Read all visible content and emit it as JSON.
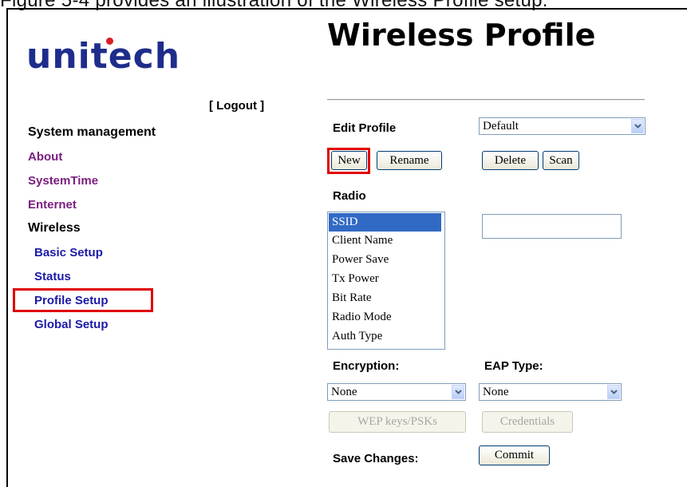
{
  "header": {
    "cut_text": "Figure 5-4 provides an illustration of the Wireless Profile setup.",
    "logo": "unitech",
    "logout_left": "[",
    "logout_link": "Logout",
    "logout_right": "]",
    "page_title": "Wireless Profile"
  },
  "sidebar": {
    "section": "System management",
    "items": [
      {
        "label": "About"
      },
      {
        "label": "SystemTime"
      },
      {
        "label": "Enternet"
      },
      {
        "label": "Wireless"
      },
      {
        "label": "Basic Setup"
      },
      {
        "label": "Status"
      },
      {
        "label": "Profile Setup"
      },
      {
        "label": "Global Setup"
      }
    ],
    "highlighted": "Profile Setup"
  },
  "main": {
    "edit_profile_label": "Edit Profile",
    "profile_select_value": "Default",
    "buttons": {
      "new": "New",
      "rename": "Rename",
      "delete": "Delete",
      "scan": "Scan",
      "wep": "WEP keys/PSKs",
      "credentials": "Credentials",
      "commit": "Commit"
    },
    "radio_label": "Radio",
    "radio_options": [
      "SSID",
      "Client Name",
      "Power Save",
      "Tx Power",
      "Bit Rate",
      "Radio Mode",
      "Auth Type"
    ],
    "radio_selected": "SSID",
    "ssid_value": "",
    "encryption_label": "Encryption:",
    "encryption_value": "None",
    "eap_label": "EAP Type:",
    "eap_value": "None",
    "save_label": "Save Changes:"
  },
  "colors": {
    "logo": "#1e2d8c",
    "nav_purple": "#7a1f80",
    "nav_blue": "#1a1aa8",
    "highlight": "#e00000",
    "selection": "#316ac5"
  }
}
